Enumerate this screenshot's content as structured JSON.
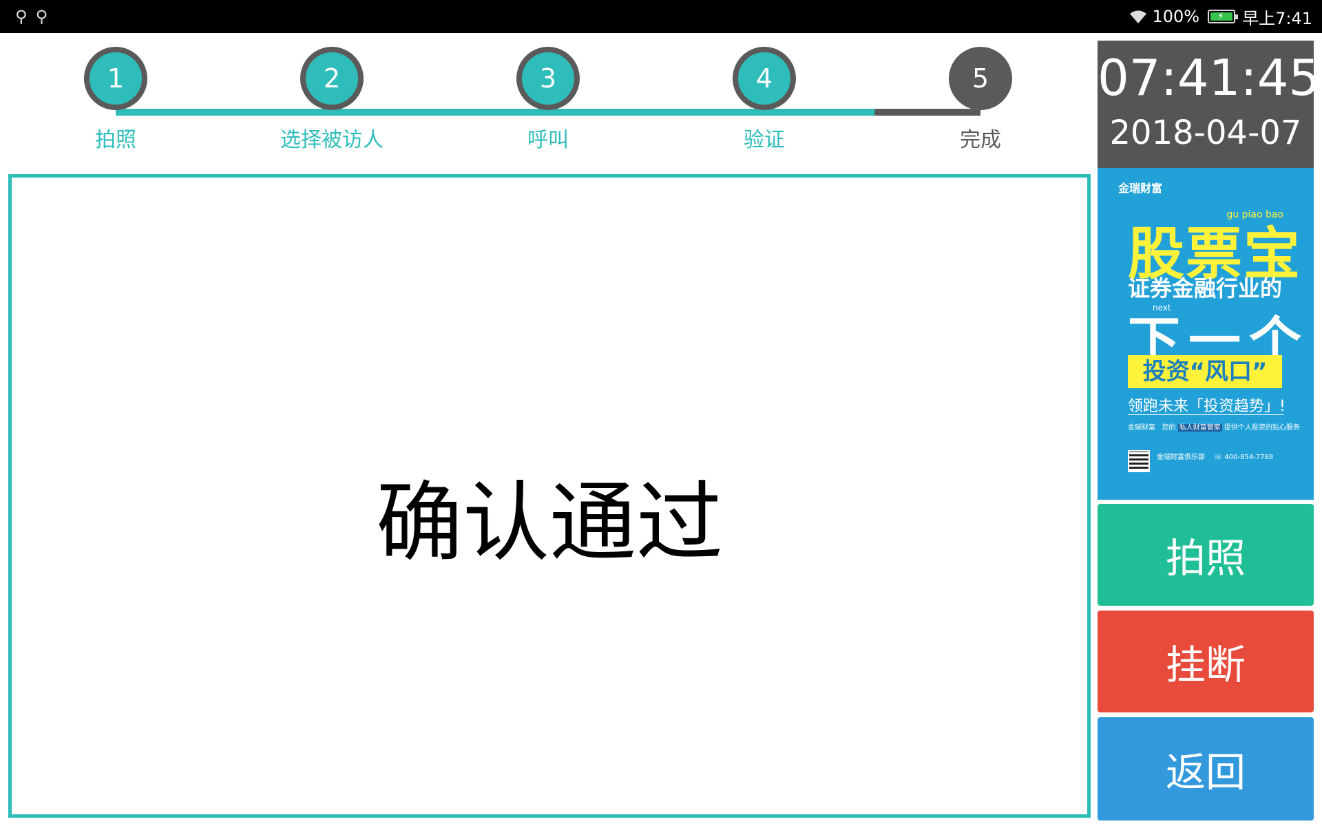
{
  "status_bar": {
    "left_icons": [
      "usb-icon",
      "usb-icon"
    ],
    "battery_percent": "100%",
    "time": "早上7:41"
  },
  "stepper": {
    "active_color": "#2fbdbb",
    "pending_color": "#5a5a5a",
    "steps": [
      {
        "number": "1",
        "label": "拍照",
        "done": true
      },
      {
        "number": "2",
        "label": "选择被访人",
        "done": true
      },
      {
        "number": "3",
        "label": "呼叫",
        "done": true
      },
      {
        "number": "4",
        "label": "验证",
        "done": true
      },
      {
        "number": "5",
        "label": "完成",
        "done": false
      }
    ]
  },
  "main": {
    "message": "确认通过",
    "border_color": "#2fbdbb"
  },
  "clock": {
    "time": "07:41:45",
    "date": "2018-04-07"
  },
  "ad": {
    "brand": "金瑞财富",
    "pinyin": "gu piao bao",
    "title": "股票宝",
    "line1": "证券金融行业的",
    "next_tag": "next",
    "line2": "下一个",
    "line3": "投资“风口”",
    "line4": "领跑未来「投资趋势」!",
    "line5_a": "金瑞财富",
    "line5_b": "您的",
    "line5_highlight": "私人财富管家",
    "line5_c": "提供个人投资的贴心服务",
    "club": "金瑞财富俱乐部",
    "phone": "400-854-7788"
  },
  "buttons": {
    "photo": "拍照",
    "hangup": "挂断",
    "back": "返回",
    "colors": {
      "photo": "#1fbe96",
      "hangup": "#e84b3c",
      "back": "#3399dd"
    }
  }
}
